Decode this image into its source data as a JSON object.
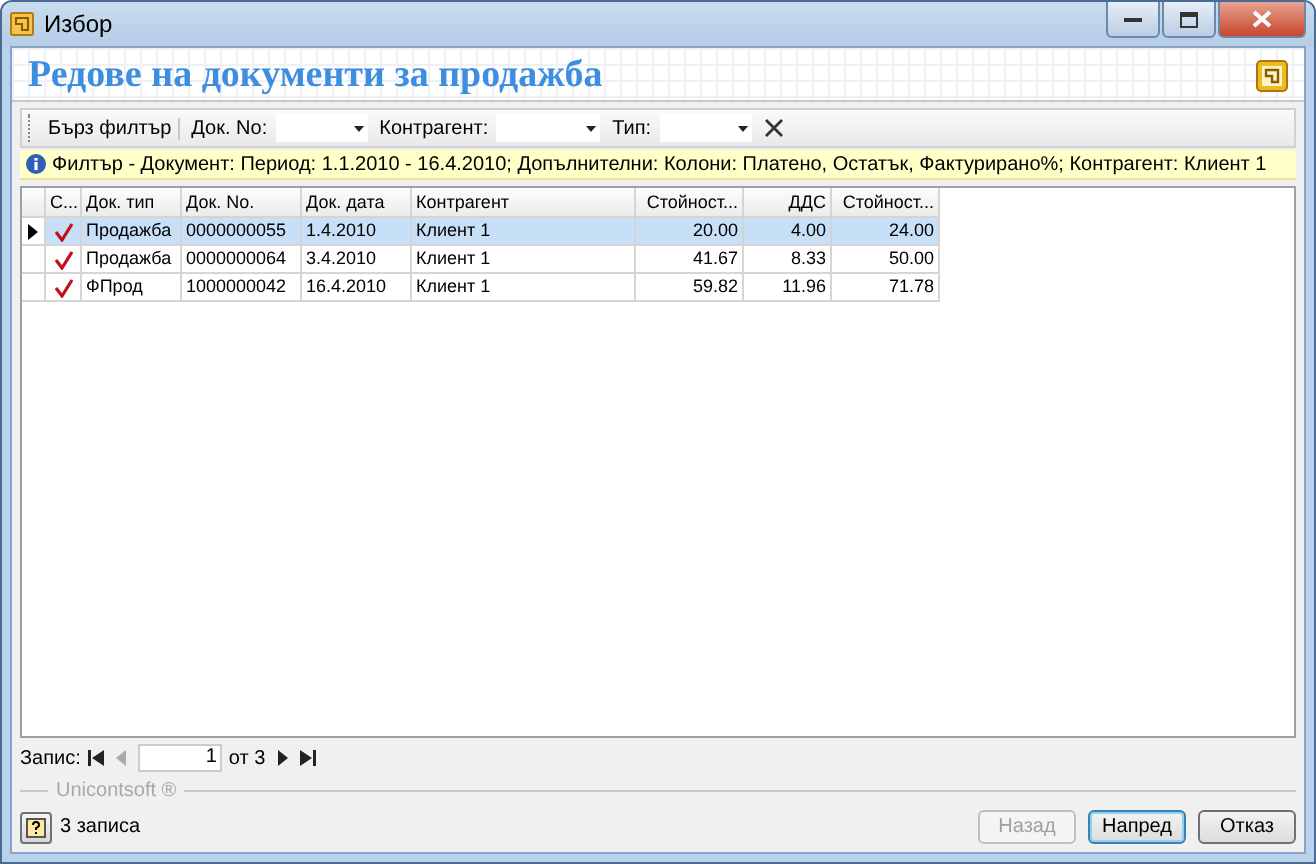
{
  "window": {
    "title": "Избор"
  },
  "header": {
    "title": "Редове на документи за продажба"
  },
  "toolbar": {
    "quick_filter": "Бърз филтър",
    "filters": [
      {
        "label": "Док. No:"
      },
      {
        "label": "Контрагент:"
      },
      {
        "label": "Тип:"
      }
    ]
  },
  "filter_info": "Филтър - Документ: Период: 1.1.2010 - 16.4.2010; Допълнителни: Колони: Платено, Остатък, Фактурирано%; Контрагент: Клиент 1",
  "table": {
    "columns": [
      {
        "label": "С...",
        "kind": "check"
      },
      {
        "label": "Док. тип",
        "kind": "text"
      },
      {
        "label": "Док. No.",
        "kind": "text"
      },
      {
        "label": "Док. дата",
        "kind": "text"
      },
      {
        "label": "Контрагент",
        "kind": "text"
      },
      {
        "label": "Стойност...",
        "kind": "number"
      },
      {
        "label": "ДДС",
        "kind": "number"
      },
      {
        "label": "Стойност...",
        "kind": "number"
      }
    ],
    "rows": [
      {
        "selected": true,
        "checked": true,
        "cells": [
          "",
          "Продажба",
          "0000000055",
          "1.4.2010",
          "Клиент 1",
          "20.00",
          "4.00",
          "24.00"
        ]
      },
      {
        "selected": false,
        "checked": true,
        "cells": [
          "",
          "Продажба",
          "0000000064",
          "3.4.2010",
          "Клиент 1",
          "41.67",
          "8.33",
          "50.00"
        ]
      },
      {
        "selected": false,
        "checked": true,
        "cells": [
          "",
          "ФПрод",
          "1000000042",
          "16.4.2010",
          "Клиент 1",
          "59.82",
          "11.96",
          "71.78"
        ]
      }
    ]
  },
  "navigator": {
    "label": "Запис:",
    "value": "1",
    "total": "от 3"
  },
  "brand": "Unicontsoft ®",
  "status": "3 записа",
  "buttons": [
    {
      "label": "Назад",
      "disabled": true,
      "default": false
    },
    {
      "label": "Напред",
      "disabled": false,
      "default": true
    },
    {
      "label": "Отказ",
      "disabled": false,
      "default": false
    }
  ]
}
